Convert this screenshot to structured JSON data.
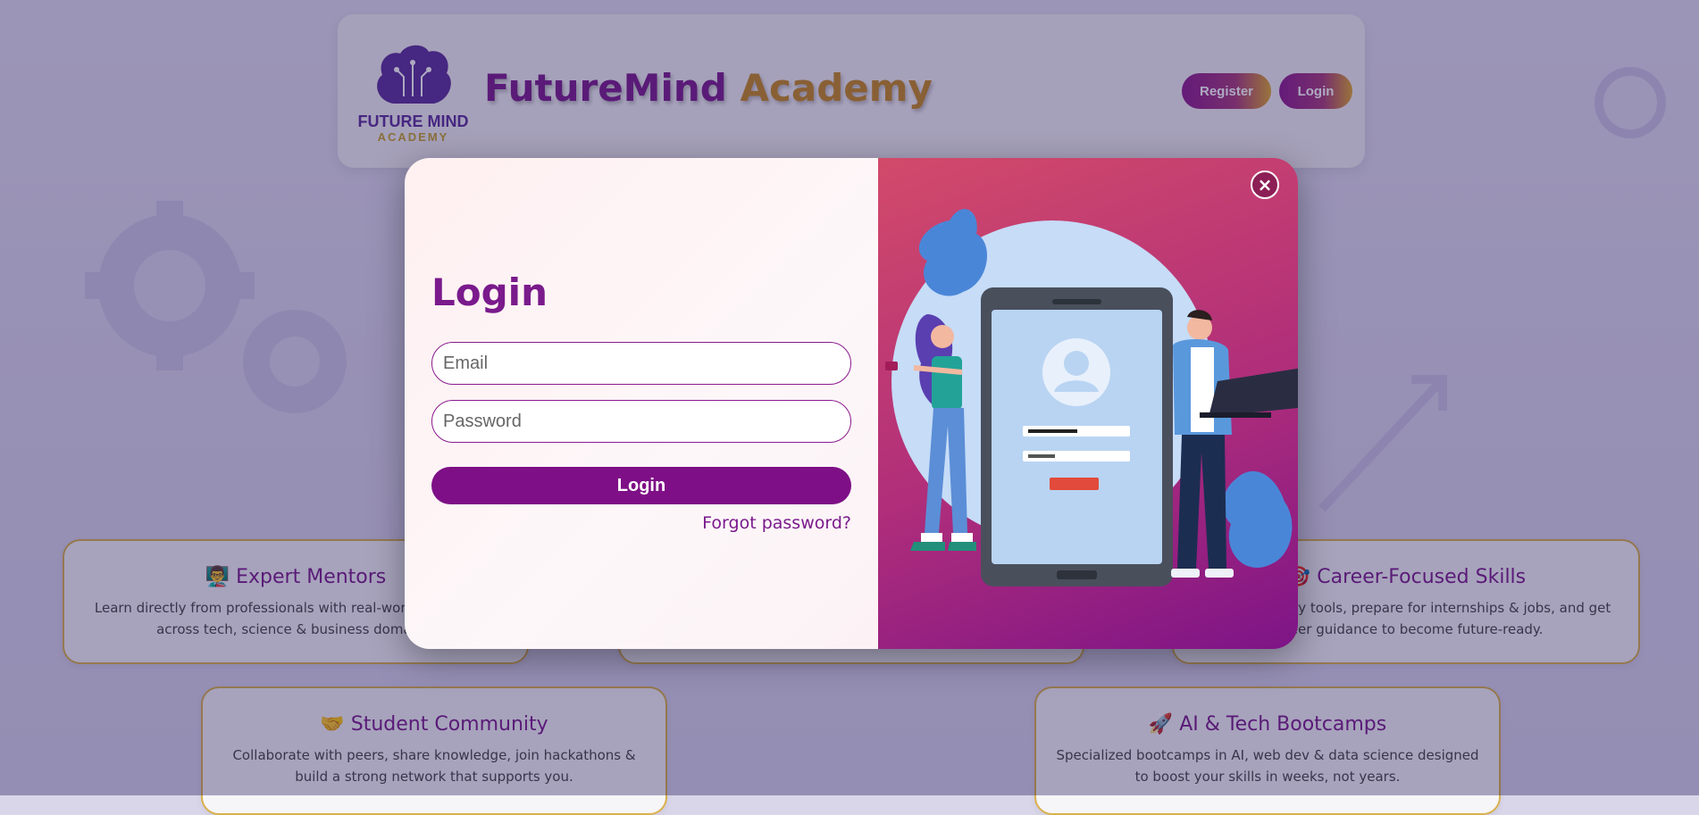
{
  "header": {
    "logo_line1": "FUTURE MIND",
    "logo_line2": "ACADEMY",
    "title_part1": "FutureMind",
    "title_part2": "Academy",
    "register_label": "Register",
    "login_label": "Login"
  },
  "cards": [
    {
      "icon": "👨‍🏫",
      "title": "Expert Mentors",
      "text": "Learn directly from professionals with real-world experience across tech, science & business domains."
    },
    {
      "icon": "🎯",
      "title": "Career-Focused Skills",
      "text": "Master industry tools, prepare for internships & jobs, and get career guidance to become future-ready."
    },
    {
      "icon": "🤝",
      "title": "Student Community",
      "text": "Collaborate with peers, share knowledge, join hackathons & build a strong network that supports you."
    },
    {
      "icon": "🚀",
      "title": "AI & Tech Bootcamps",
      "text": "Specialized bootcamps in AI, web dev & data science designed to boost your skills in weeks, not years."
    }
  ],
  "modal": {
    "title": "Login",
    "email_placeholder": "Email",
    "password_placeholder": "Password",
    "login_button": "Login",
    "forgot_link": "Forgot password?",
    "close_glyph": "×"
  },
  "colors": {
    "brand_purple": "#7a1a8c",
    "brand_gold": "#c58a1f"
  }
}
